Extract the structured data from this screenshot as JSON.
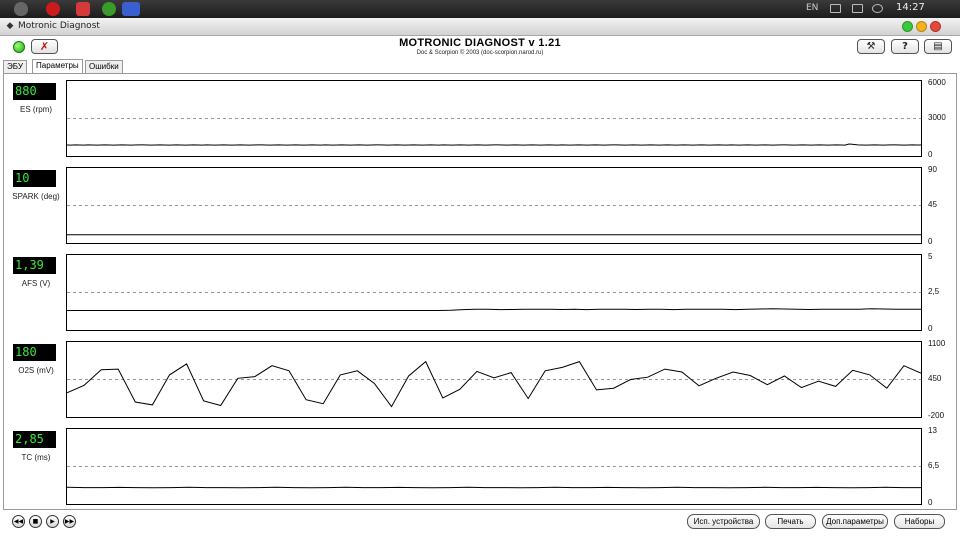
{
  "taskbar": {
    "language": "EN",
    "clock": "14:27",
    "icons": [
      "apple-icon",
      "opera-icon",
      "app-icon",
      "utorrent-icon",
      "network-icon"
    ]
  },
  "window": {
    "title": "Motronic Diagnost",
    "controls": [
      "minimize",
      "maximize",
      "close"
    ]
  },
  "header": {
    "title": "MOTRONIC DIAGNOST v 1.21",
    "subtitle": "Doc & Scorpion © 2003     (doc-scorpion.narod.ru)",
    "connection_status_color": "#22b022",
    "disconnect_icon": "disconnect-icon",
    "tool_icons": [
      "tools-icon",
      "help-icon",
      "book-icon"
    ]
  },
  "tabs": [
    {
      "label": "ЭБУ",
      "active": false
    },
    {
      "label": "Параметры",
      "active": true
    },
    {
      "label": "Ошибки",
      "active": false
    }
  ],
  "parameters": [
    {
      "id": "es",
      "value": "880",
      "label": "ES (rpm)",
      "ticks": [
        "6000",
        "3000",
        "0"
      ],
      "min": 0,
      "max": 6000
    },
    {
      "id": "spark",
      "value": "10",
      "label": "SPARK (deg)",
      "ticks": [
        "90",
        "45",
        "0"
      ],
      "min": 0,
      "max": 90
    },
    {
      "id": "afs",
      "value": "1,39",
      "label": "AFS (V)",
      "ticks": [
        "5",
        "2,5",
        "0"
      ],
      "min": 0,
      "max": 5
    },
    {
      "id": "o2s",
      "value": "180",
      "label": "O2S (mV)",
      "ticks": [
        "1100",
        "450",
        "-200"
      ],
      "min": -200,
      "max": 1100
    },
    {
      "id": "tc",
      "value": "2,85",
      "label": "TC (ms)",
      "ticks": [
        "13",
        "6,5",
        "0"
      ],
      "min": 0,
      "max": 13
    }
  ],
  "chart_data": [
    {
      "type": "line",
      "name": "ES (rpm)",
      "ylim": [
        0,
        6000
      ],
      "values": [
        880,
        870,
        890,
        880,
        875,
        885,
        880,
        870,
        880,
        890,
        880,
        875,
        880,
        885,
        880,
        870,
        880,
        885,
        890,
        880,
        875,
        880,
        885,
        880,
        870,
        880,
        885,
        880,
        875,
        880,
        890,
        880,
        875,
        885,
        880,
        870,
        880,
        890,
        880,
        875,
        880,
        885,
        880,
        870,
        880,
        885,
        890,
        880,
        875,
        880,
        885,
        880,
        870,
        880,
        885,
        880,
        875,
        880,
        890,
        880,
        875,
        885,
        880,
        870,
        880,
        890,
        880,
        875,
        880,
        885,
        880,
        870,
        880,
        885,
        890,
        880,
        875,
        880,
        885,
        880,
        870,
        880,
        885,
        880,
        875,
        880,
        890,
        880,
        875,
        885,
        880,
        870,
        880,
        890,
        880,
        875,
        880,
        885,
        880,
        870,
        880,
        885,
        890,
        880,
        875,
        880,
        885,
        880,
        870,
        880,
        885,
        880,
        875,
        880,
        890,
        880,
        875,
        885,
        880,
        870,
        880,
        890,
        880,
        875,
        880,
        885,
        880,
        870,
        880,
        885,
        890,
        880,
        875,
        880,
        885,
        880,
        870,
        880,
        885,
        880,
        875,
        880,
        890,
        880,
        875,
        880,
        885,
        880,
        870,
        880,
        885,
        880,
        875,
        880,
        890,
        880,
        875,
        885,
        880,
        870,
        880,
        890,
        880,
        875,
        880,
        885,
        880,
        870,
        880,
        885,
        890,
        880,
        875,
        880,
        885,
        880,
        870,
        880,
        885,
        880,
        875,
        880,
        890,
        880,
        875,
        960,
        930,
        890,
        880,
        875,
        880,
        885,
        880,
        870,
        880,
        885,
        890,
        880,
        875,
        880,
        885,
        880,
        880
      ]
    },
    {
      "type": "line",
      "name": "SPARK (deg)",
      "ylim": [
        0,
        90
      ],
      "values": [
        10,
        10,
        10,
        10,
        10,
        10,
        10,
        10,
        10,
        10,
        10,
        10,
        10,
        10,
        10,
        10,
        10,
        10,
        10,
        10,
        10,
        10,
        10,
        10,
        10,
        10,
        10,
        10,
        10,
        10,
        10,
        10,
        10,
        10,
        10,
        10,
        10,
        10,
        10,
        10,
        10,
        10,
        10,
        10,
        10,
        10,
        10,
        10,
        10,
        10
      ]
    },
    {
      "type": "line",
      "name": "AFS (V)",
      "ylim": [
        0,
        5
      ],
      "values": [
        1.3,
        1.3,
        1.3,
        1.3,
        1.3,
        1.3,
        1.3,
        1.3,
        1.3,
        1.3,
        1.3,
        1.3,
        1.3,
        1.3,
        1.3,
        1.3,
        1.3,
        1.3,
        1.3,
        1.3,
        1.3,
        1.3,
        1.3,
        1.3,
        1.3,
        1.3,
        1.3,
        1.3,
        1.3,
        1.3,
        1.3,
        1.32,
        1.36,
        1.38,
        1.38,
        1.36,
        1.37,
        1.38,
        1.38,
        1.38,
        1.37,
        1.38,
        1.36,
        1.38,
        1.38,
        1.38,
        1.37,
        1.38,
        1.38,
        1.36,
        1.38,
        1.38,
        1.39,
        1.38,
        1.36,
        1.38,
        1.4,
        1.42,
        1.4,
        1.38,
        1.37,
        1.38,
        1.38,
        1.38,
        1.39,
        1.42,
        1.4,
        1.39,
        1.38,
        1.39
      ]
    },
    {
      "type": "line",
      "name": "O2S (mV)",
      "ylim": [
        -200,
        1100
      ],
      "values": [
        220,
        350,
        620,
        630,
        60,
        10,
        530,
        720,
        80,
        0,
        470,
        500,
        690,
        600,
        100,
        30,
        530,
        600,
        380,
        -20,
        510,
        760,
        130,
        280,
        590,
        480,
        570,
        120,
        600,
        660,
        760,
        270,
        300,
        450,
        490,
        630,
        580,
        340,
        470,
        580,
        520,
        360,
        510,
        310,
        420,
        330,
        610,
        530,
        300,
        690,
        560
      ]
    },
    {
      "type": "line",
      "name": "TC (ms)",
      "ylim": [
        0,
        13
      ],
      "values": [
        2.9,
        2.85,
        2.85,
        2.88,
        2.85,
        2.8,
        2.85,
        2.9,
        2.85,
        2.85,
        2.82,
        2.85,
        2.9,
        2.85,
        2.8,
        2.85,
        2.9,
        2.85,
        2.85,
        2.88,
        2.85,
        2.82,
        2.85,
        2.9,
        2.85,
        2.85,
        2.8,
        2.85,
        2.9,
        2.85,
        2.85,
        2.88,
        2.85,
        2.82,
        2.85,
        2.9,
        2.85,
        2.85,
        2.8,
        2.85,
        2.9,
        2.85,
        2.85,
        2.88,
        2.85,
        2.82,
        2.85,
        2.9,
        2.85,
        2.85
      ]
    }
  ],
  "player": {
    "buttons": [
      "rewind-icon",
      "stop-icon",
      "play-icon",
      "forward-icon"
    ]
  },
  "footer": {
    "buttons": [
      "Исп. устройства",
      "Печать",
      "Доп.параметры",
      "Наборы"
    ]
  }
}
